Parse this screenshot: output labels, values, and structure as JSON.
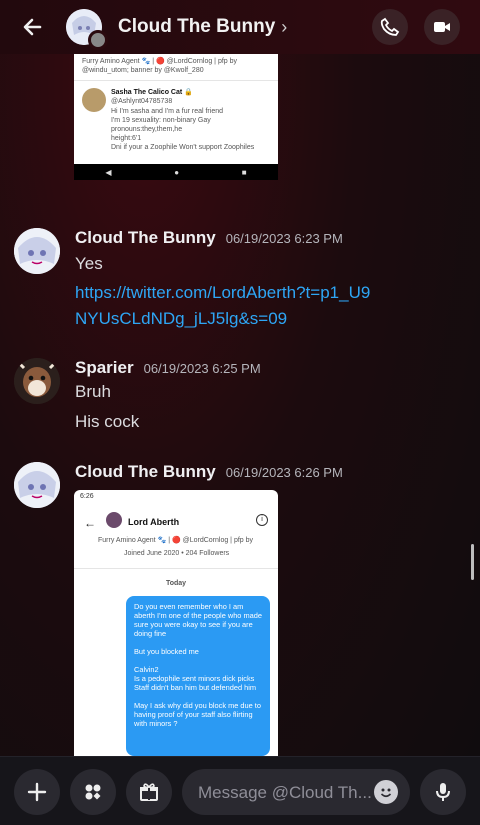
{
  "header": {
    "title": "Cloud The Bunny",
    "chevron": "›",
    "back_icon": "arrow-left-icon",
    "call_icon": "phone-icon",
    "video_icon": "video-icon"
  },
  "top_screenshot": {
    "bio_line1": "Furry Amino Agent 🐾 | 🔴 @LordCornlog | pfp by",
    "bio_line2": "@windu_utom; banner by @Kwolf_280",
    "profile_name": "Sasha The Calico Cat 🔒",
    "profile_handle": "@Ashlynt04785738",
    "profile_bio": [
      "Hi I'm sasha and I'm a fur real friend",
      "I'm 19 sexuality: non-binary Gay",
      "pronouns:they,them,he",
      "height:6'1",
      "Dni if your a Zoophile Won't support Zoophiles"
    ],
    "nav_back": "◀",
    "nav_home": "●",
    "nav_recent": "■"
  },
  "messages": [
    {
      "author": "Cloud The Bunny",
      "timestamp": "06/19/2023 6:23 PM",
      "text": "Yes",
      "link": "https://twitter.com/LordAberth?t=p1_U9NYUsCLdNDg_jLJ5lg&s=09"
    },
    {
      "author": "Sparier",
      "timestamp": "06/19/2023 6:25 PM",
      "text": "Bruh",
      "text2": "His cock"
    },
    {
      "author": "Cloud The Bunny",
      "timestamp": "06/19/2023 6:26 PM"
    }
  ],
  "bottom_screenshot": {
    "status_time": "6:26",
    "chat_title": "Lord Aberth",
    "bio_snip": "Furry Amino Agent 🐾 | 🔴 @LordCornlog | pfp by",
    "joined": "Joined June 2020 • 204 Followers",
    "day_label": "Today",
    "bubble_text": "Do you even remember who I am aberth I'm one of the people who made sure you were okay to see if you are doing fine\n\nBut you blocked me\n\nCalvin2\nIs a pedophile sent minors dick picks Staff didn't ban him but defended him\n\nMay I ask why did you block me due to having proof of your staff also flirting with minors ?"
  },
  "composer": {
    "placeholder": "Message @Cloud Th...",
    "add_icon": "plus-icon",
    "apps_icon": "apps-icon",
    "gift_icon": "gift-icon",
    "emoji_icon": "emoji-icon",
    "mic_icon": "microphone-icon"
  }
}
